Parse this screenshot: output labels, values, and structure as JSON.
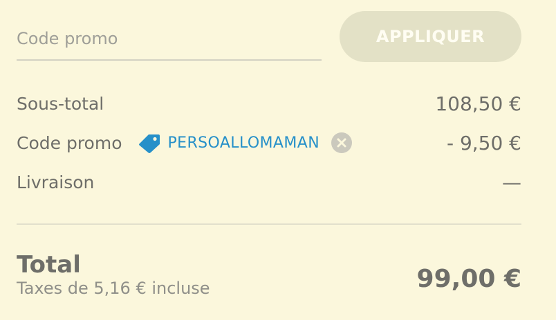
{
  "promo_form": {
    "placeholder": "Code promo",
    "value": "",
    "apply_label": "APPLIQUER"
  },
  "summary": {
    "subtotal_label": "Sous-total",
    "subtotal_value": "108,50 €",
    "promo_label": "Code promo",
    "promo_code": "PERSOALLOMAMAN",
    "promo_value": "- 9,50 €",
    "shipping_label": "Livraison",
    "shipping_value": "—"
  },
  "total": {
    "label": "Total",
    "tax_note": "Taxes de 5,16 € incluse",
    "value": "99,00 €"
  },
  "icons": {
    "tag": "tag-icon",
    "remove": "close-circle-icon"
  },
  "colors": {
    "background": "#fbf7dc",
    "accent": "#2690c9",
    "button_bg": "#e3e1c6",
    "text": "#6e6e69"
  }
}
